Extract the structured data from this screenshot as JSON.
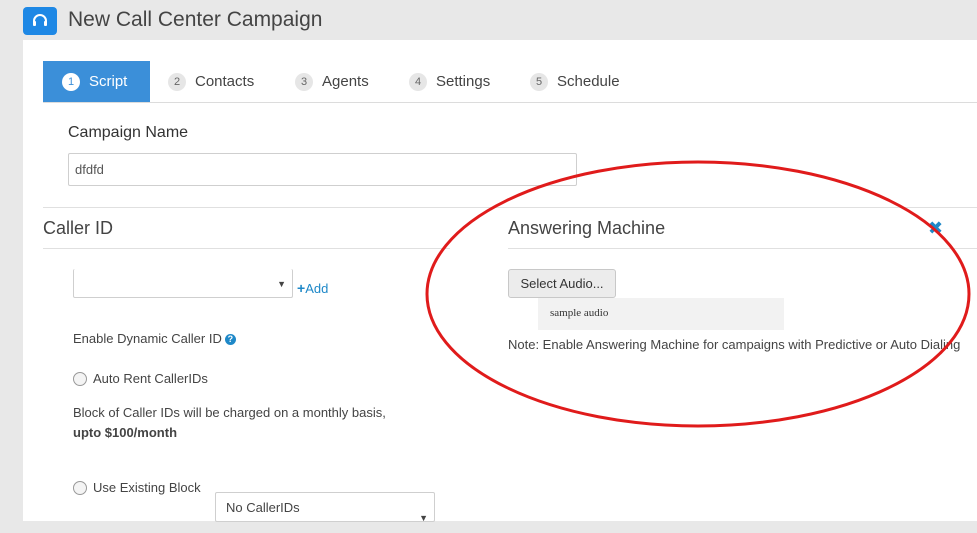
{
  "header": {
    "title": "New Call Center Campaign",
    "app_icon": "headset-icon"
  },
  "tabs": [
    {
      "num": "1",
      "label": "Script"
    },
    {
      "num": "2",
      "label": "Contacts"
    },
    {
      "num": "3",
      "label": "Agents"
    },
    {
      "num": "4",
      "label": "Settings"
    },
    {
      "num": "5",
      "label": "Schedule"
    }
  ],
  "campaign": {
    "label": "Campaign Name",
    "value": "dfdfd"
  },
  "caller_id": {
    "heading": "Caller ID",
    "select_value": "",
    "add_label": "Add",
    "dynamic_label": "Enable Dynamic Caller ID",
    "auto_rent_label": "Auto Rent CallerIDs",
    "block_note": "Block of Caller IDs will be charged on a monthly basis,",
    "block_price": "upto $100/month",
    "use_existing_label": "Use Existing Block",
    "existing_select": "No CallerIDs"
  },
  "answering_machine": {
    "heading": "Answering Machine",
    "select_audio_label": "Select Audio...",
    "audio_file": "sample audio",
    "note": "Note: Enable Answering Machine for campaigns with Predictive or Auto Dialing"
  },
  "colors": {
    "accent": "#3b8fd9",
    "annotation": "#e01b1b"
  }
}
